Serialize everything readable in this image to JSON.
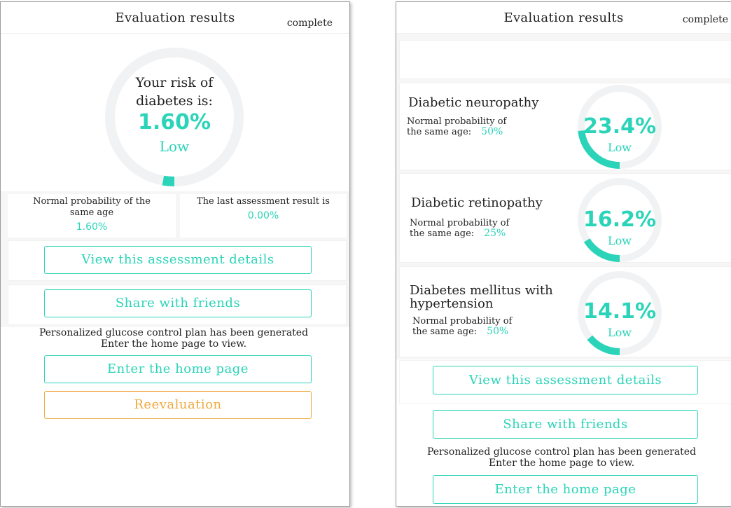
{
  "left": {
    "title": "Evaluation results",
    "complete": "complete",
    "risk_label": "Your risk of diabetes is:",
    "risk_pct": "1.60%",
    "risk_level": "Low",
    "risk_fraction": 0.016,
    "normal_label": "Normal probability of the same age",
    "normal_value": "1.60%",
    "last_label": "The last assessment result is",
    "last_value": "0.00%",
    "btn_details": "View this assessment details",
    "btn_share": "Share with friends",
    "notice_line1": "Personalized glucose control plan has been generated",
    "notice_line2": "Enter the home page to view.",
    "btn_home": "Enter the home page",
    "btn_reeval": "Reevaluation"
  },
  "right": {
    "title": "Evaluation results",
    "complete": "complete",
    "conditions": [
      {
        "name": "Diabetic neuropathy",
        "normal_label": "Normal probability of the same age:",
        "normal_value": "50%",
        "pct": "23.4%",
        "level": "Low",
        "fraction": 0.234
      },
      {
        "name": "Diabetic retinopathy",
        "normal_label": "Normal probability of the same age:",
        "normal_value": "25%",
        "pct": "16.2%",
        "level": "Low",
        "fraction": 0.162
      },
      {
        "name": "Diabetes mellitus with hypertension",
        "normal_label": "Normal probability of the same age:",
        "normal_value": "50%",
        "pct": "14.1%",
        "level": "Low",
        "fraction": 0.141
      }
    ],
    "btn_details": "View this assessment details",
    "btn_share": "Share with friends",
    "notice_line1": "Personalized glucose control plan has been generated",
    "notice_line2": "Enter the home page to view.",
    "btn_home": "Enter the home page"
  },
  "colors": {
    "accent": "#2bd4b8",
    "orange": "#f0a83c",
    "ring_track": "#f1f2f4"
  }
}
